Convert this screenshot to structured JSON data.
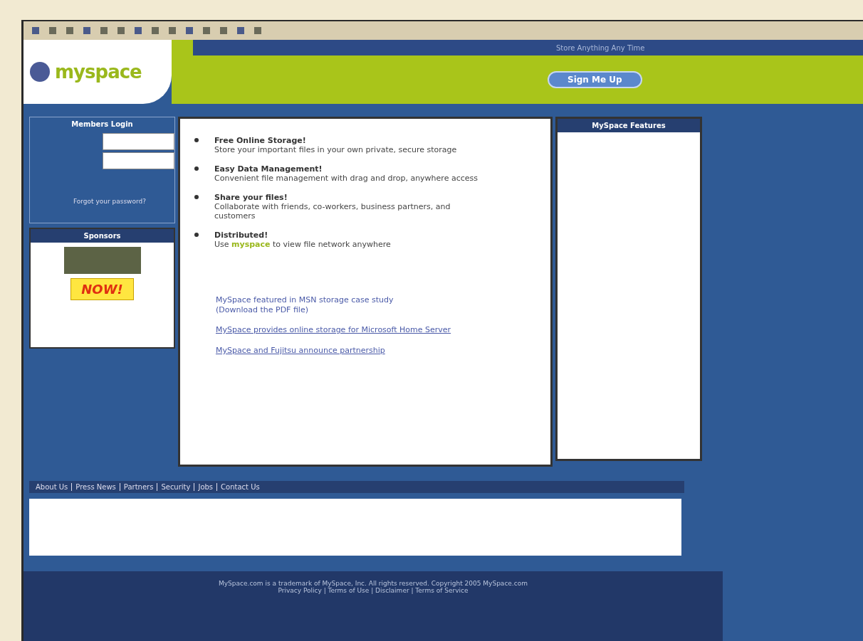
{
  "header": {
    "logo": "myspace",
    "tagline": "Store Anything Any Time",
    "signup_button": "Sign Me Up"
  },
  "login": {
    "title": "Members Login",
    "forgot_link": "Forgot your password?"
  },
  "sponsors": {
    "title": "Sponsors",
    "badge": "NOW!"
  },
  "features": [
    {
      "title": "Free Online Storage!",
      "text": "Store your important files in your own private, secure storage"
    },
    {
      "title": "Easy Data Management!",
      "text": "Convenient file management with drag and drop, anywhere access"
    },
    {
      "title": "Share your files!",
      "text": "Collaborate with friends, co-workers, business partners, and customers"
    },
    {
      "title": "Distributed!",
      "text": "Use **myspace** to view file network anywhere"
    }
  ],
  "links": [
    {
      "text": "MySpace featured in MSN storage case study",
      "note": "(Download the PDF file)",
      "underlined": false
    },
    {
      "text": "MySpace provides online storage for Microsoft Home Server",
      "underlined": true
    },
    {
      "text": "MySpace and Fujitsu announce partnership",
      "underlined": true
    }
  ],
  "side_panel": {
    "title": "MySpace Features"
  },
  "footer_links": [
    "About Us",
    "Press News",
    "Partners",
    "Security",
    "Jobs",
    "Contact Us"
  ],
  "copyright": [
    "MySpace.com is a trademark of MySpace, Inc. All rights reserved. Copyright 2005 MySpace.com",
    "Privacy Policy | Terms of Use | Disclaimer | Terms of Service"
  ]
}
